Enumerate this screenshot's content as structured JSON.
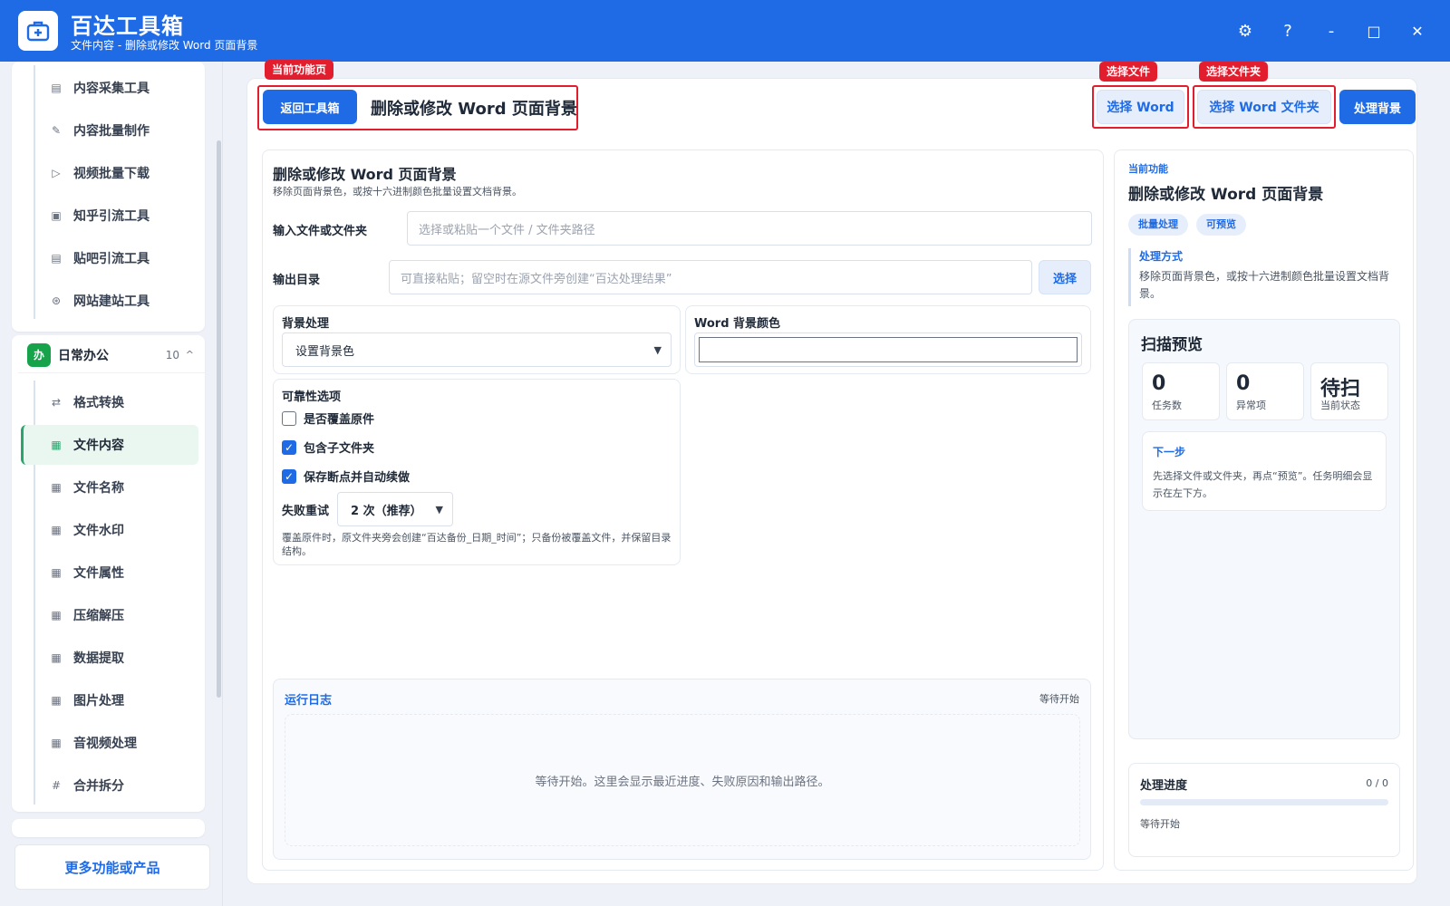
{
  "app": {
    "title": "百达工具箱",
    "subtitle": "文件内容 - 删除或修改 Word 页面背景"
  },
  "window": {
    "settings": "⚙",
    "help": "?",
    "minimize": "-",
    "maximize": "□",
    "close": "✕"
  },
  "sidebar": {
    "top_items": [
      {
        "icon": "▤",
        "label": "内容采集工具"
      },
      {
        "icon": "✎",
        "label": "内容批量制作"
      },
      {
        "icon": "▷",
        "label": "视频批量下载"
      },
      {
        "icon": "▣",
        "label": "知乎引流工具"
      },
      {
        "icon": "▤",
        "label": "贴吧引流工具"
      },
      {
        "icon": "⊛",
        "label": "网站建站工具"
      }
    ],
    "group": {
      "badge": "办",
      "title": "日常办公",
      "count": "10",
      "caret": "^"
    },
    "group_items": [
      {
        "icon": "⇄",
        "label": "格式转换"
      },
      {
        "icon": "▦",
        "label": "文件内容"
      },
      {
        "icon": "▦",
        "label": "文件名称"
      },
      {
        "icon": "▦",
        "label": "文件水印"
      },
      {
        "icon": "▦",
        "label": "文件属性"
      },
      {
        "icon": "▦",
        "label": "压缩解压"
      },
      {
        "icon": "▦",
        "label": "数据提取"
      },
      {
        "icon": "▦",
        "label": "图片处理"
      },
      {
        "icon": "▦",
        "label": "音视频处理"
      },
      {
        "icon": "#",
        "label": "合并拆分"
      }
    ],
    "more": "更多功能或产品"
  },
  "tags": {
    "current": "当前功能页",
    "select_file": "选择文件",
    "select_folder": "选择文件夹"
  },
  "toolbar": {
    "back": "返回工具箱",
    "title": "删除或修改 Word 页面背景",
    "select_word": "选择 Word",
    "select_folder": "选择 Word 文件夹",
    "process": "处理背景"
  },
  "form": {
    "title": "删除或修改 Word 页面背景",
    "desc": "移除页面背景色，或按十六进制颜色批量设置文档背景。",
    "input_label": "输入文件或文件夹",
    "input_placeholder": "选择或粘贴一个文件 / 文件夹路径",
    "output_label": "输出目录",
    "output_placeholder": "可直接粘贴；留空时在源文件旁创建“百达处理结果”",
    "output_btn": "选择",
    "bg_label": "背景处理",
    "bg_value": "设置背景色",
    "color_label": "Word 背景颜色",
    "color_value": "",
    "reliability_title": "可靠性选项",
    "overwrite": "是否覆盖原件",
    "subfolders": "包含子文件夹",
    "resume": "保存断点并自动续做",
    "retry_label": "失败重试",
    "retry_value": "2 次（推荐）",
    "note": "覆盖原件时，原文件夹旁会创建“百达备份_日期_时间”；只备份被覆盖文件，并保留目录结构。"
  },
  "log": {
    "title": "运行日志",
    "status": "等待开始",
    "empty": "等待开始。这里会显示最近进度、失败原因和输出路径。"
  },
  "info": {
    "eyebrow": "当前功能",
    "title": "删除或修改 Word 页面背景",
    "pills": [
      "批量处理",
      "可预览"
    ],
    "method_title": "处理方式",
    "method_desc": "移除页面背景色，或按十六进制颜色批量设置文档背景。"
  },
  "preview": {
    "title": "扫描预览",
    "stats": [
      {
        "value": "0",
        "label": "任务数"
      },
      {
        "value": "0",
        "label": "异常项"
      },
      {
        "value": "待扫",
        "label": "当前状态"
      }
    ],
    "next_title": "下一步",
    "next_desc": "先选择文件或文件夹，再点“预览”。任务明细会显示在左下方。"
  },
  "progress": {
    "title": "处理进度",
    "count": "0 / 0",
    "value": 0,
    "status": "等待开始"
  },
  "colors": {
    "primary": "#1f6be6",
    "accent_green": "#16a34a",
    "annotation_red": "#e11d2e"
  }
}
